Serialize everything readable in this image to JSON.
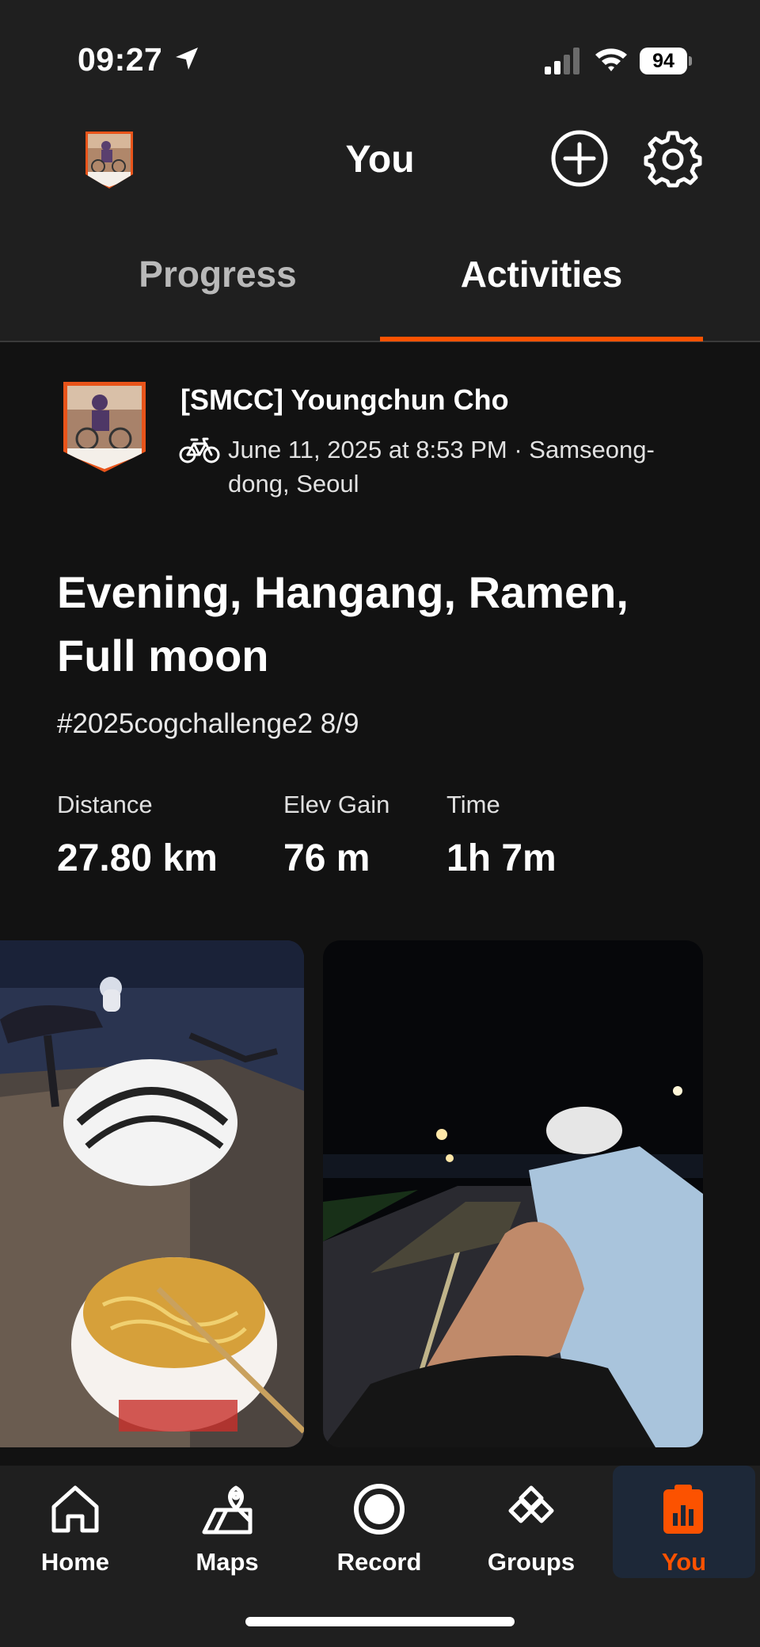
{
  "status_bar": {
    "time": "09:27",
    "battery": "94",
    "icons": [
      "location-arrow-icon",
      "cellular-signal-icon",
      "wifi-icon",
      "battery-icon"
    ]
  },
  "header": {
    "title": "You",
    "icons": [
      "avatar",
      "add-circle-icon",
      "gear-icon"
    ]
  },
  "tabs": [
    {
      "label": "Progress",
      "active": false
    },
    {
      "label": "Activities",
      "active": true
    }
  ],
  "activity": {
    "athlete": "[SMCC] Youngchun Cho",
    "sport_icon": "bike-icon",
    "meta": "June 11, 2025 at 8:53 PM · Samseong-dong, Seoul",
    "title": "Evening, Hangang, Ramen, Full moon",
    "description": "#2025cogchallenge2 8/9",
    "stats": [
      {
        "label": "Distance",
        "value": "27.80 km"
      },
      {
        "label": "Elev Gain",
        "value": "76 m"
      },
      {
        "label": "Time",
        "value": "1h 7m"
      }
    ]
  },
  "bottom_nav": [
    {
      "label": "Home",
      "icon": "home-icon",
      "active": false
    },
    {
      "label": "Maps",
      "icon": "maps-icon",
      "active": false
    },
    {
      "label": "Record",
      "icon": "record-icon",
      "active": false
    },
    {
      "label": "Groups",
      "icon": "groups-icon",
      "active": false
    },
    {
      "label": "You",
      "icon": "you-icon",
      "active": true
    }
  ],
  "colors": {
    "accent": "#fc5200",
    "background": "#121212",
    "bar": "#1f1f1f",
    "active_nav_bg": "#1d2838"
  }
}
